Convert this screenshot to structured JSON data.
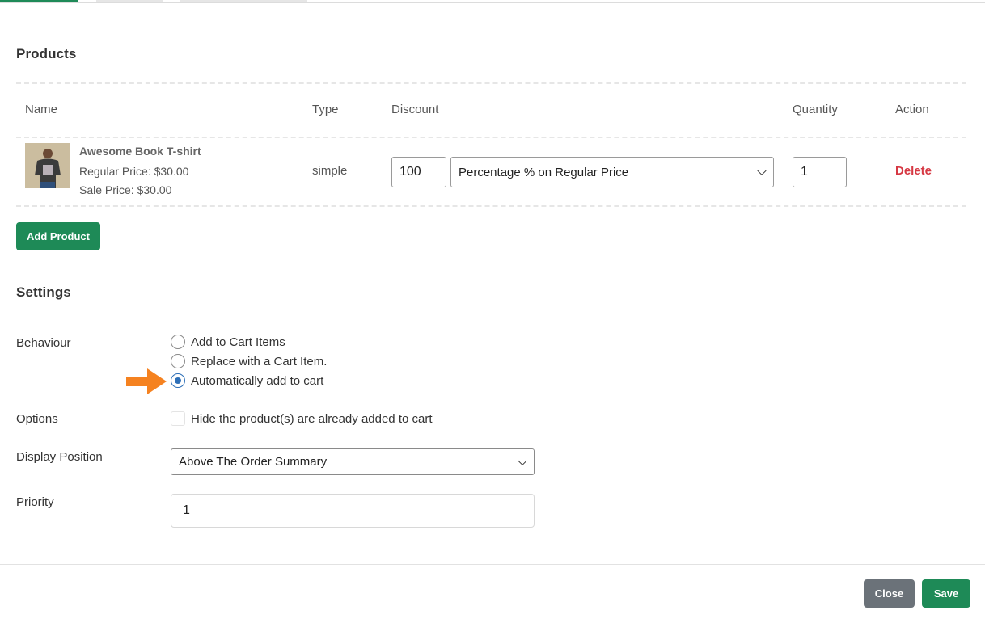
{
  "products": {
    "title": "Products",
    "columns": [
      "Name",
      "Type",
      "Discount",
      "Quantity",
      "Action"
    ],
    "rows": [
      {
        "name": "Awesome Book T-shirt",
        "regular_price": "Regular Price: $30.00",
        "sale_price": "Sale Price: $30.00",
        "type": "simple",
        "discount_value": "100",
        "discount_type": "Percentage % on Regular Price",
        "quantity": "1",
        "action": "Delete"
      }
    ],
    "add_button": "Add Product"
  },
  "settings": {
    "title": "Settings",
    "behaviour_label": "Behaviour",
    "behaviour_options": [
      "Add to Cart Items",
      "Replace with a Cart Item.",
      "Automatically add to cart"
    ],
    "behaviour_selected": "Automatically add to cart",
    "options_label": "Options",
    "options_checkbox": "Hide the product(s) are already added to cart",
    "options_checked": false,
    "display_position_label": "Display Position",
    "display_position_value": "Above The Order Summary",
    "priority_label": "Priority",
    "priority_value": "1"
  },
  "footer": {
    "close_label": "Close",
    "save_label": "Save"
  },
  "colors": {
    "primary_green": "#1e8a57",
    "delete_red": "#d63843",
    "radio_blue": "#2d6fb7",
    "arrow_orange": "#f58220",
    "close_gray": "#6b7279"
  }
}
